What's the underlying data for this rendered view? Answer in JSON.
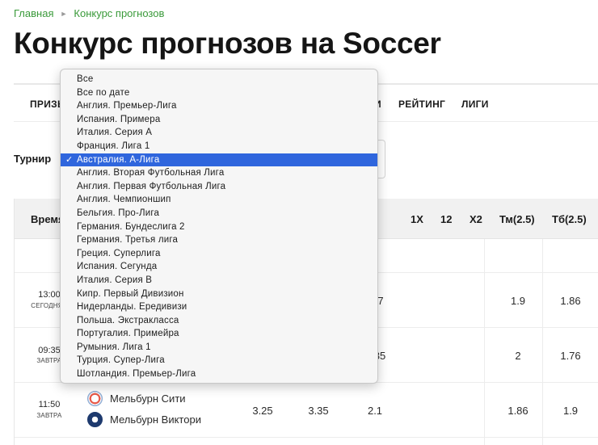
{
  "breadcrumb": {
    "home": "Главная",
    "current": "Конкурс прогнозов"
  },
  "title": "Конкурс прогнозов на Soccer",
  "nav": {
    "items": [
      "ПРИЗЫ",
      "РЕЙТИНГ",
      "ЛИГИ"
    ],
    "partial": "И"
  },
  "filter": {
    "label": "Турнир"
  },
  "table": {
    "headers": {
      "time": "Время",
      "x1": "1X",
      "x12": "12",
      "x2": "X2",
      "under": "Тм(2.5)",
      "over": "Тб(2.5)"
    },
    "rows": [
      {
        "time": "13:00",
        "date": "СЕГОДНЯ",
        "partial_odd": "7",
        "under": "1.9",
        "over": "1.86"
      },
      {
        "time": "09:35",
        "date": "ЗАВТРА",
        "partial_odd": "85",
        "under": "2",
        "over": "1.76"
      },
      {
        "time": "11:50",
        "date": "ЗАВТРА",
        "home": "Мельбурн Сити",
        "away": "Мельбурн Виктори",
        "odd1": "3.25",
        "oddX": "3.35",
        "odd2": "2.1",
        "under": "1.86",
        "over": "1.9"
      }
    ]
  },
  "dropdown": {
    "options": [
      "Все",
      "Все по дате",
      "Англия. Премьер-Лига",
      "Испания. Примера",
      "Италия. Серия А",
      "Франция. Лига 1",
      "Австралия. А-Лига",
      "Англия. Вторая Футбольная Лига",
      "Англия. Первая Футбольная Лига",
      "Англия. Чемпионшип",
      "Бельгия. Про-Лига",
      "Германия. Бундеслига 2",
      "Германия. Третья лига",
      "Греция. Суперлига",
      "Испания. Сегунда",
      "Италия. Серия В",
      "Кипр. Первый Дивизион",
      "Нидерланды. Ередивизи",
      "Польша. Экстракласса",
      "Португалия. Примейра",
      "Румыния. Лига 1",
      "Турция. Супер-Лига",
      "Шотландия. Премьер-Лига"
    ],
    "selected": "Австралия. А-Лига",
    "check": "✓"
  },
  "colors": {
    "accent": "#3a9a3a",
    "selection": "#2f66dd",
    "header_bg": "#f1f1f1"
  }
}
